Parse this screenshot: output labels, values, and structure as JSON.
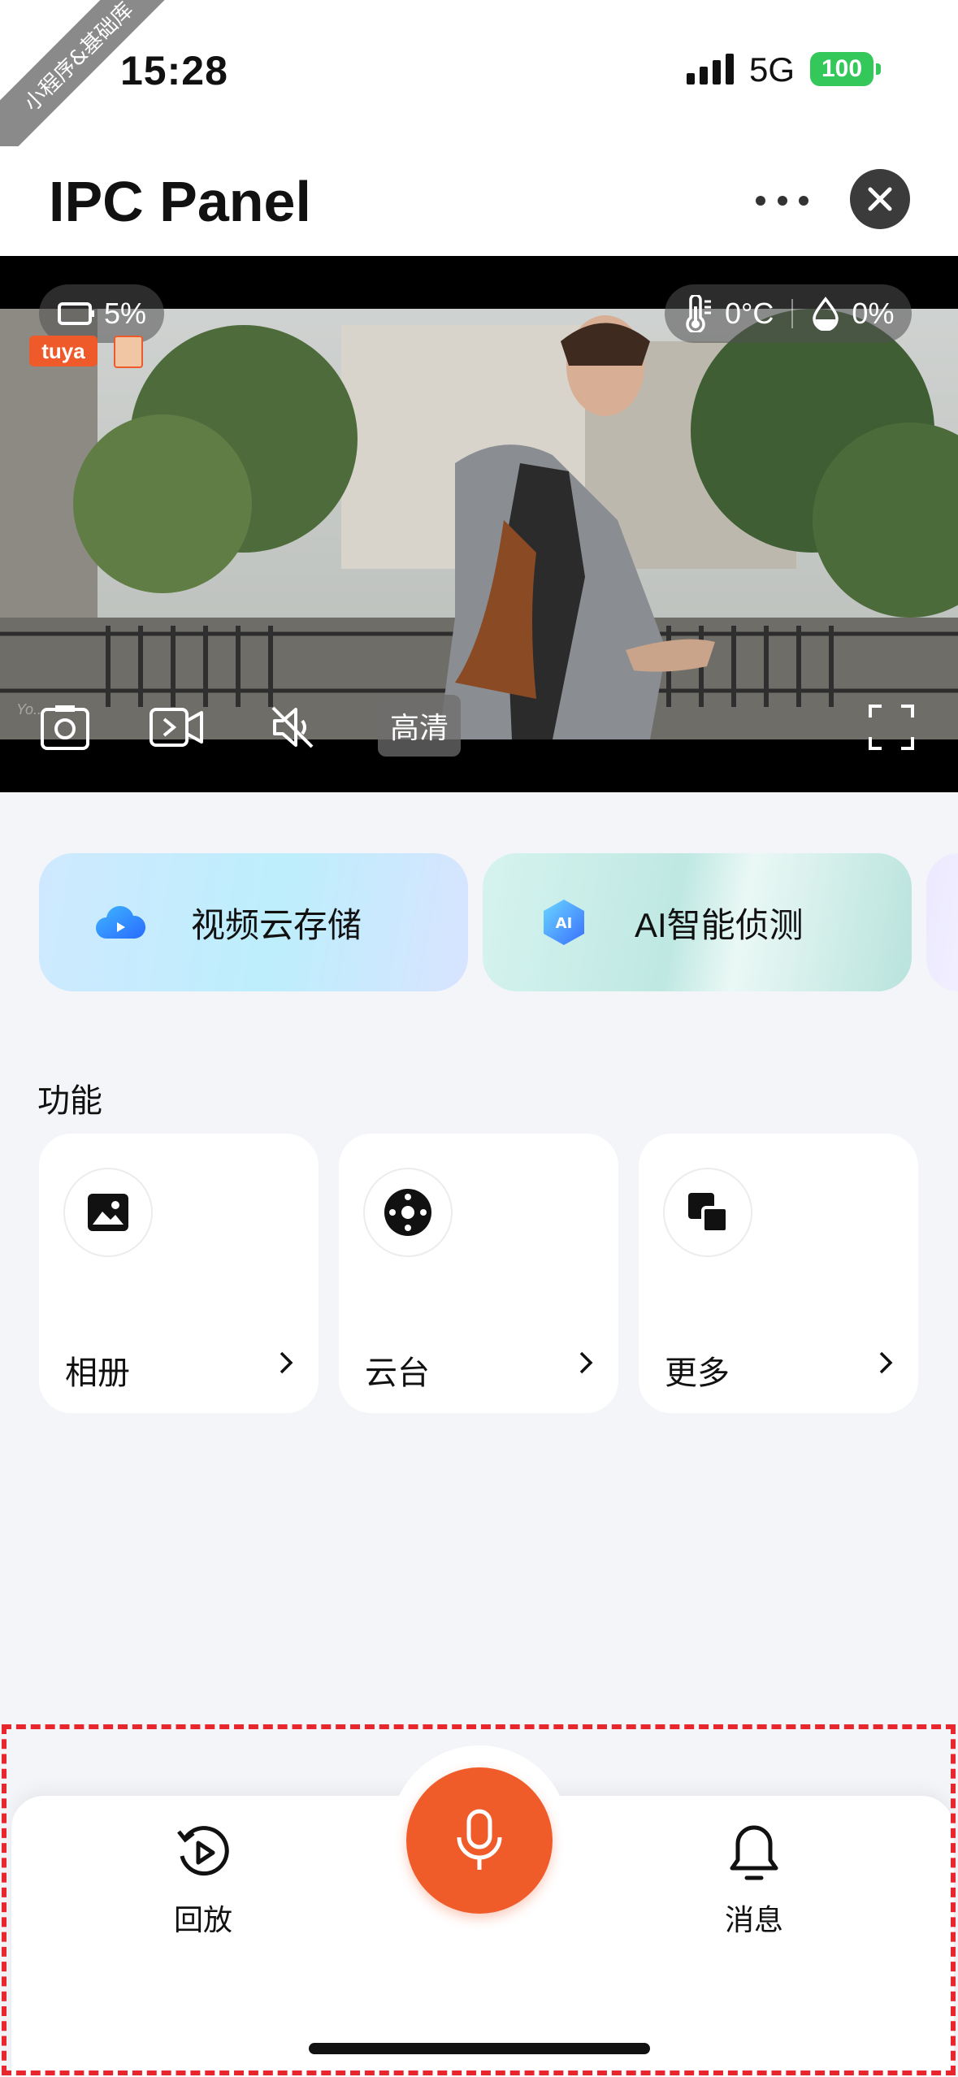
{
  "status_bar": {
    "ribbon": "小程序&基础库",
    "time": "15:28",
    "network": "5G",
    "battery": "100"
  },
  "nav": {
    "title": "IPC Panel"
  },
  "video": {
    "battery_level": "5%",
    "temperature": "0°C",
    "humidity": "0%",
    "brand": "tuya",
    "quality_label": "高清",
    "watermark": "Yo..."
  },
  "promos": [
    {
      "label": "视频云存储",
      "icon": "cloud-storage-icon"
    },
    {
      "label": "AI智能侦测",
      "icon": "ai-detect-icon"
    }
  ],
  "functions": {
    "title": "功能",
    "items": [
      {
        "label": "相册",
        "icon": "album-icon"
      },
      {
        "label": "云台",
        "icon": "ptz-icon"
      },
      {
        "label": "更多",
        "icon": "more-icon"
      }
    ]
  },
  "dock": {
    "playback_label": "回放",
    "messages_label": "消息",
    "mic_icon": "microphone-icon"
  },
  "colors": {
    "accent": "#ef5b29",
    "battery": "#34c759",
    "dashed_frame": "#e8262d"
  }
}
